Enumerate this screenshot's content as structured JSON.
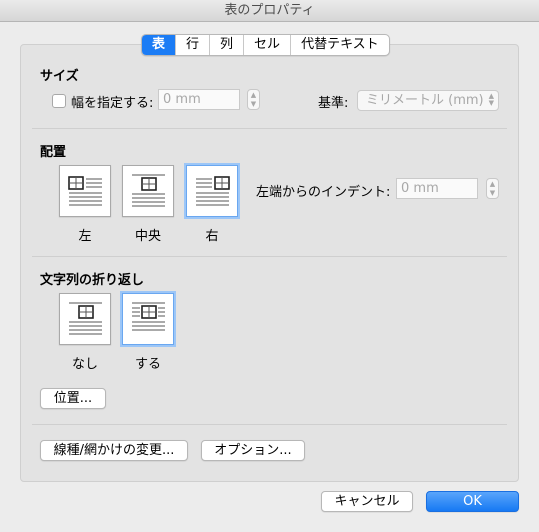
{
  "window": {
    "title": "表のプロパティ"
  },
  "tabs": [
    {
      "label": "表",
      "active": true
    },
    {
      "label": "行"
    },
    {
      "label": "列"
    },
    {
      "label": "セル"
    },
    {
      "label": "代替テキスト"
    }
  ],
  "size": {
    "title": "サイズ",
    "width_checkbox_label": "幅を指定する:",
    "width_checked": false,
    "width_value": "0 mm",
    "basis_label": "基準:",
    "basis_value": "ミリメートル (mm)"
  },
  "alignment": {
    "title": "配置",
    "options": [
      {
        "label": "左",
        "selected": false
      },
      {
        "label": "中央",
        "selected": false
      },
      {
        "label": "右",
        "selected": true
      }
    ],
    "indent_label": "左端からのインデント:",
    "indent_value": "0 mm"
  },
  "wrapping": {
    "title": "文字列の折り返し",
    "options": [
      {
        "label": "なし",
        "selected": false
      },
      {
        "label": "する",
        "selected": true
      }
    ],
    "position_button": "位置..."
  },
  "footer_buttons": {
    "borders": "線種/網かけの変更...",
    "options": "オプション..."
  },
  "dialog_buttons": {
    "cancel": "キャンセル",
    "ok": "OK"
  },
  "colors": {
    "accent": "#1b7cf5",
    "selection_ring": "#9cc6f7"
  }
}
